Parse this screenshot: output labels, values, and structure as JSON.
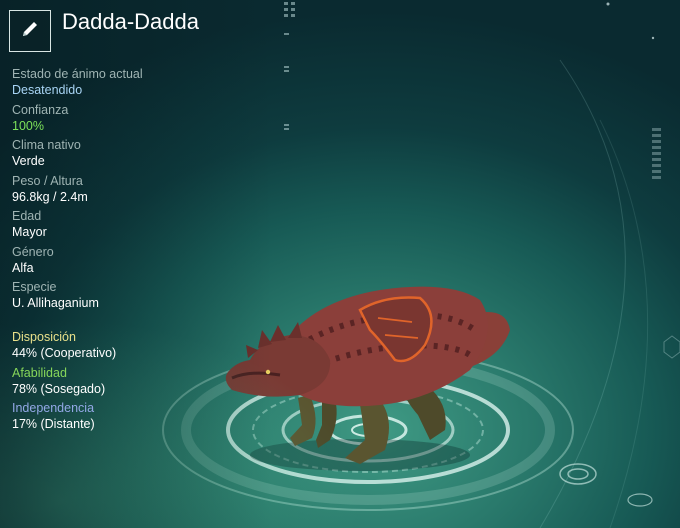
{
  "creature": {
    "name": "Dadda-Dadda"
  },
  "stats": [
    {
      "label": "Estado de ánimo actual",
      "value": "Desatendido",
      "value_color": "#a8d4f4"
    },
    {
      "label": "Confianza",
      "value": "100%",
      "value_color": "#7ce25a"
    },
    {
      "label": "Clima nativo",
      "value": "Verde",
      "value_color": "#ffffff"
    },
    {
      "label": "Peso / Altura",
      "value": "96.8kg / 2.4m",
      "value_color": "#ffffff"
    },
    {
      "label": "Edad",
      "value": "Mayor",
      "value_color": "#ffffff"
    },
    {
      "label": "Género",
      "value": "Alfa",
      "value_color": "#ffffff"
    },
    {
      "label": "Especie",
      "value": "U. Allihaganium",
      "value_color": "#ffffff"
    }
  ],
  "traits": [
    {
      "label": "Disposición",
      "value": "44% (Cooperativo)",
      "label_color": "#e8e08a"
    },
    {
      "label": "Afabilidad",
      "value": "78% (Sosegado)",
      "label_color": "#86d65a"
    },
    {
      "label": "Independencia",
      "value": "17% (Distante)",
      "label_color": "#93a8e6"
    }
  ],
  "icons": {
    "edit": "pencil-icon"
  }
}
